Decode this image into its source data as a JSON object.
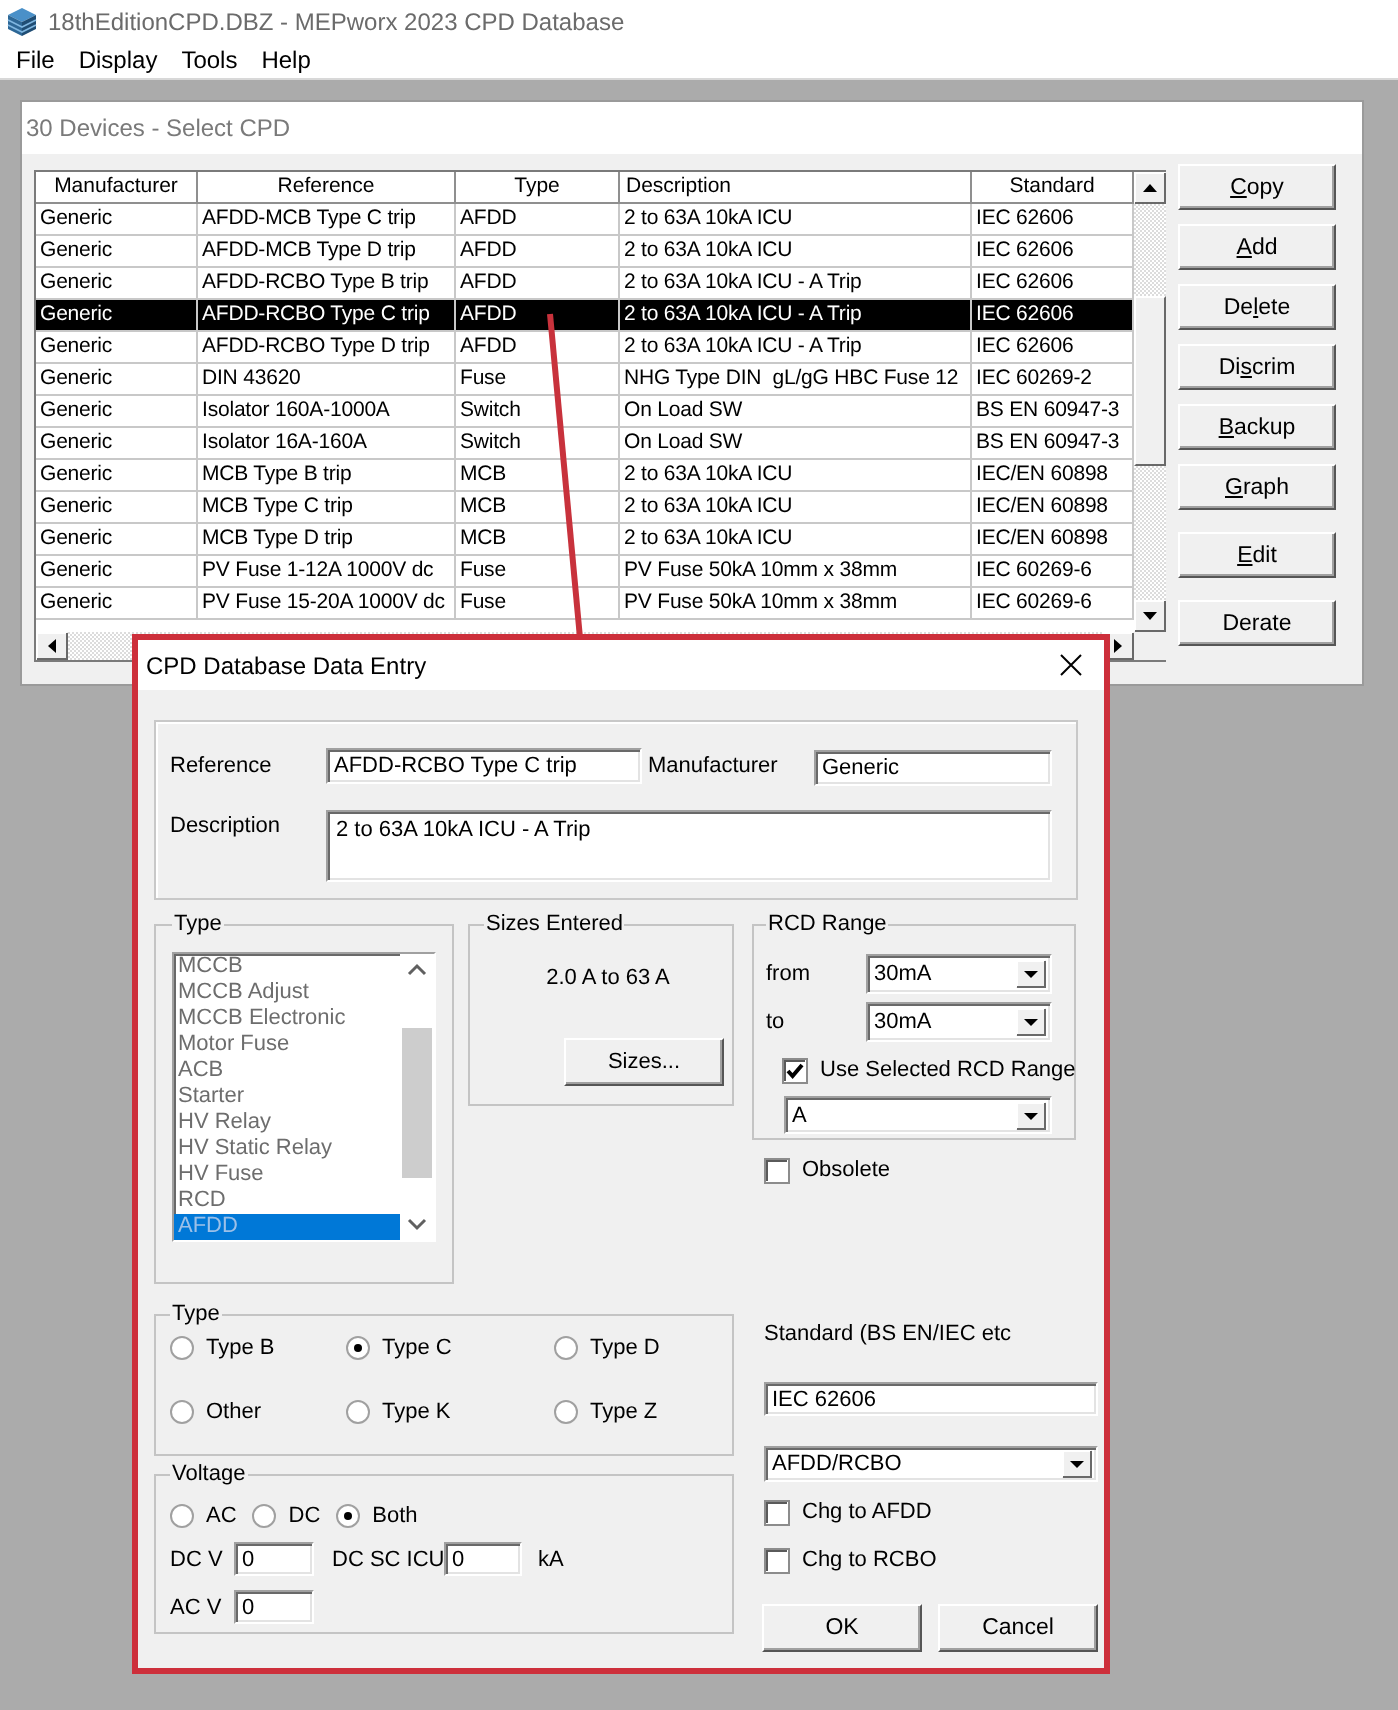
{
  "app_window": {
    "title": "18thEditionCPD.DBZ - MEPworx 2023 CPD Database",
    "menu": [
      "File",
      "Display",
      "Tools",
      "Help"
    ]
  },
  "device_window": {
    "title": "30 Devices - Select CPD",
    "table": {
      "columns": [
        {
          "label": "Manufacturer",
          "kind": "centered"
        },
        {
          "label": "Reference",
          "kind": "centered"
        },
        {
          "label": "Type",
          "kind": "centered"
        },
        {
          "label": "Description",
          "kind": "left"
        },
        {
          "label": "Standard",
          "kind": "centered"
        }
      ],
      "rows": [
        {
          "cells": [
            "Generic",
            "AFDD-MCB Type C trip",
            "AFDD",
            "2 to 63A 10kA ICU",
            "IEC 62606"
          ],
          "selected": false
        },
        {
          "cells": [
            "Generic",
            "AFDD-MCB Type D trip",
            "AFDD",
            "2 to 63A 10kA ICU",
            "IEC 62606"
          ],
          "selected": false
        },
        {
          "cells": [
            "Generic",
            "AFDD-RCBO Type B trip",
            "AFDD",
            "2 to 63A 10kA ICU - A Trip",
            "IEC 62606"
          ],
          "selected": false
        },
        {
          "cells": [
            "Generic",
            "AFDD-RCBO Type C trip",
            "AFDD",
            "2 to 63A 10kA ICU - A Trip",
            "IEC 62606"
          ],
          "selected": true
        },
        {
          "cells": [
            "Generic",
            "AFDD-RCBO Type D trip",
            "AFDD",
            "2 to 63A 10kA ICU - A Trip",
            "IEC 62606"
          ],
          "selected": false
        },
        {
          "cells": [
            "Generic",
            "DIN 43620",
            "Fuse",
            "NHG Type DIN  gL/gG HBC Fuse 12",
            "IEC 60269-2"
          ],
          "selected": false
        },
        {
          "cells": [
            "Generic",
            "Isolator 160A-1000A",
            "Switch",
            "On Load SW",
            "BS EN 60947-3"
          ],
          "selected": false
        },
        {
          "cells": [
            "Generic",
            "Isolator 16A-160A",
            "Switch",
            "On Load SW",
            "BS EN 60947-3"
          ],
          "selected": false
        },
        {
          "cells": [
            "Generic",
            "MCB Type B trip",
            "MCB",
            "2 to 63A 10kA ICU",
            "IEC/EN 60898"
          ],
          "selected": false
        },
        {
          "cells": [
            "Generic",
            "MCB Type C trip",
            "MCB",
            "2 to 63A 10kA ICU",
            "IEC/EN 60898"
          ],
          "selected": false
        },
        {
          "cells": [
            "Generic",
            "MCB Type D trip",
            "MCB",
            "2 to 63A 10kA ICU",
            "IEC/EN 60898"
          ],
          "selected": false
        },
        {
          "cells": [
            "Generic",
            "PV Fuse 1-12A 1000V dc",
            "Fuse",
            "PV Fuse 50kA 10mm x 38mm",
            "IEC 60269-6"
          ],
          "selected": false
        },
        {
          "cells": [
            "Generic",
            "PV Fuse 15-20A 1000V dc",
            "Fuse",
            "PV Fuse 50kA 10mm x 38mm",
            "IEC 60269-6"
          ],
          "selected": false
        }
      ]
    },
    "buttons": [
      {
        "label_parts": [
          {
            "text": "C",
            "underlined": true
          },
          {
            "text": "opy",
            "underlined": false
          }
        ]
      },
      {
        "label_parts": [
          {
            "text": "A",
            "underlined": true
          },
          {
            "text": "dd",
            "underlined": false
          }
        ]
      },
      {
        "label_parts": [
          {
            "text": "De",
            "underlined": false
          },
          {
            "text": "l",
            "underlined": true
          },
          {
            "text": "ete",
            "underlined": false
          }
        ]
      },
      {
        "label_parts": [
          {
            "text": "Di",
            "underlined": false
          },
          {
            "text": "s",
            "underlined": true
          },
          {
            "text": "crim",
            "underlined": false
          }
        ]
      },
      {
        "label_parts": [
          {
            "text": "B",
            "underlined": true
          },
          {
            "text": "ackup",
            "underlined": false
          }
        ]
      },
      {
        "label_parts": [
          {
            "text": "G",
            "underlined": true
          },
          {
            "text": "raph",
            "underlined": false
          }
        ]
      },
      {
        "label_parts": [
          {
            "text": "E",
            "underlined": true
          },
          {
            "text": "dit",
            "underlined": false
          }
        ]
      },
      {
        "label_parts": [
          {
            "text": "Derate",
            "underlined": false
          }
        ]
      }
    ]
  },
  "data_entry_dialog": {
    "title": "CPD Database Data Entry",
    "reference": {
      "label": "Reference",
      "value": "AFDD-RCBO Type C trip"
    },
    "manufacturer": {
      "label": "Manufacturer",
      "value": "Generic"
    },
    "description": {
      "label": "Description",
      "value": "2 to 63A 10kA ICU - A Trip"
    },
    "device_type": {
      "title": "Type",
      "disabled": true,
      "items": [
        {
          "label": "MCCB",
          "selected": false
        },
        {
          "label": "MCCB Adjust",
          "selected": false
        },
        {
          "label": "MCCB Electronic",
          "selected": false
        },
        {
          "label": "Motor Fuse",
          "selected": false
        },
        {
          "label": "ACB",
          "selected": false
        },
        {
          "label": "Starter",
          "selected": false
        },
        {
          "label": "HV Relay",
          "selected": false
        },
        {
          "label": "HV Static Relay",
          "selected": false
        },
        {
          "label": "HV Fuse",
          "selected": false
        },
        {
          "label": "RCD",
          "selected": false
        },
        {
          "label": "AFDD",
          "selected": true
        }
      ]
    },
    "sizes_entered": {
      "title": "Sizes Entered",
      "range": "2.0 A to 63 A",
      "button": "Sizes..."
    },
    "rcd_range": {
      "title": "RCD Range",
      "from": {
        "label": "from",
        "value": "30mA"
      },
      "to": {
        "label": "to",
        "value": "30mA"
      },
      "use_selected": {
        "label": "Use Selected RCD Range",
        "checked": true
      },
      "rcd_type": "A"
    },
    "obsolete": {
      "label": "Obsolete",
      "checked": false
    },
    "trip_type": {
      "title": "Type",
      "options": [
        {
          "label": "Type B",
          "selected": false
        },
        {
          "label": "Type C",
          "selected": true
        },
        {
          "label": "Type D",
          "selected": false
        },
        {
          "label": "Other",
          "selected": false
        },
        {
          "label": "Type K",
          "selected": false
        },
        {
          "label": "Type Z",
          "selected": false
        }
      ]
    },
    "voltage": {
      "title": "Voltage",
      "options": [
        {
          "label": "AC",
          "selected": false
        },
        {
          "label": "DC",
          "selected": false
        },
        {
          "label": "Both",
          "selected": true
        }
      ],
      "dc_v": {
        "label": "DC V",
        "value": "0"
      },
      "dc_sc_icu": {
        "label": "DC SC ICU",
        "value": "0",
        "unit": "kA"
      },
      "ac_v": {
        "label": "AC V",
        "value": "0"
      }
    },
    "standard": {
      "label": "Standard (BS EN/IEC etc",
      "value": "IEC 62606"
    },
    "device_class": "AFDD/RCBO",
    "change_options": [
      {
        "label": "Chg to AFDD",
        "checked": false
      },
      {
        "label": "Chg to RCBO",
        "checked": false
      }
    ],
    "buttons": [
      "OK",
      "Cancel"
    ]
  }
}
